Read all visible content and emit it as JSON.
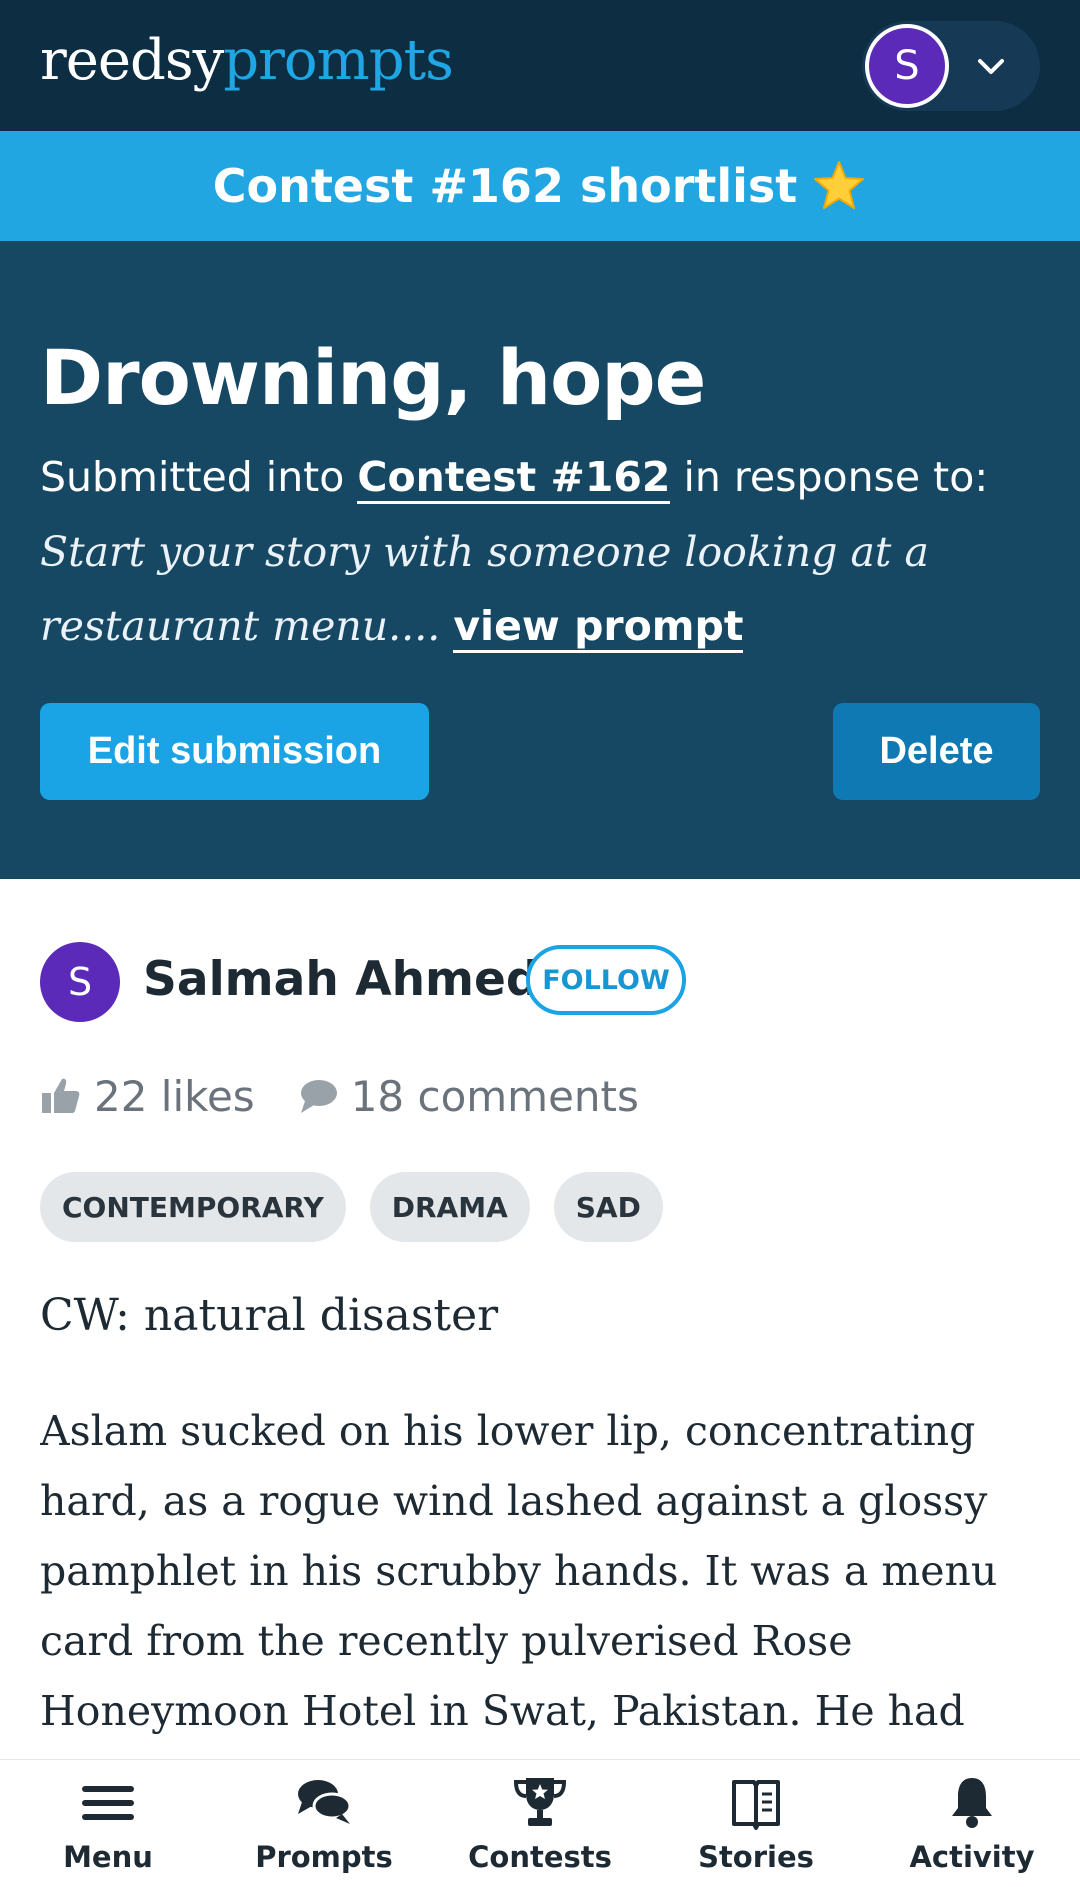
{
  "header": {
    "logo_part1": "reedsy",
    "logo_part2": "prompts",
    "user_initial": "S",
    "icons": {
      "user_menu": "chevron-down-icon"
    }
  },
  "contest_banner": {
    "text": "Contest #162 shortlist",
    "icon": "star-icon"
  },
  "story": {
    "title": "Drowning, hope",
    "submitted_prefix": "Submitted into",
    "contest_link": "Contest #162",
    "submitted_suffix": "in response to:",
    "prompt_text": "Start your story with someone looking at a restaurant menu....",
    "view_prompt": "view prompt",
    "edit_button": "Edit submission",
    "delete_button": "Delete"
  },
  "author": {
    "initial": "S",
    "name": "Salmah Ahmed",
    "follow_label": "FOLLOW"
  },
  "stats": {
    "likes": "22 likes",
    "comments": "18 comments"
  },
  "tags": [
    "CONTEMPORARY",
    "DRAMA",
    "SAD"
  ],
  "content": {
    "content_warning": "CW: natural disaster",
    "paragraph": "Aslam sucked on his lower lip, concentrating hard, as a rogue wind lashed against a glossy pamphlet in his scrubby hands. It was a menu card from the recently pulverised Rose Honeymoon Hotel in Swat, Pakistan. He had"
  },
  "bottom_nav": {
    "items": [
      {
        "label": "Menu",
        "icon": "menu-icon"
      },
      {
        "label": "Prompts",
        "icon": "chat-bubbles-icon"
      },
      {
        "label": "Contests",
        "icon": "trophy-icon"
      },
      {
        "label": "Stories",
        "icon": "book-icon"
      },
      {
        "label": "Activity",
        "icon": "bell-icon"
      }
    ]
  },
  "colors": {
    "topbar": "#0d2d43",
    "banner": "#22a6e1",
    "hero": "#164864",
    "accent": "#1aa4e6",
    "delete": "#0e79b2",
    "avatar": "#5b2ab8"
  }
}
